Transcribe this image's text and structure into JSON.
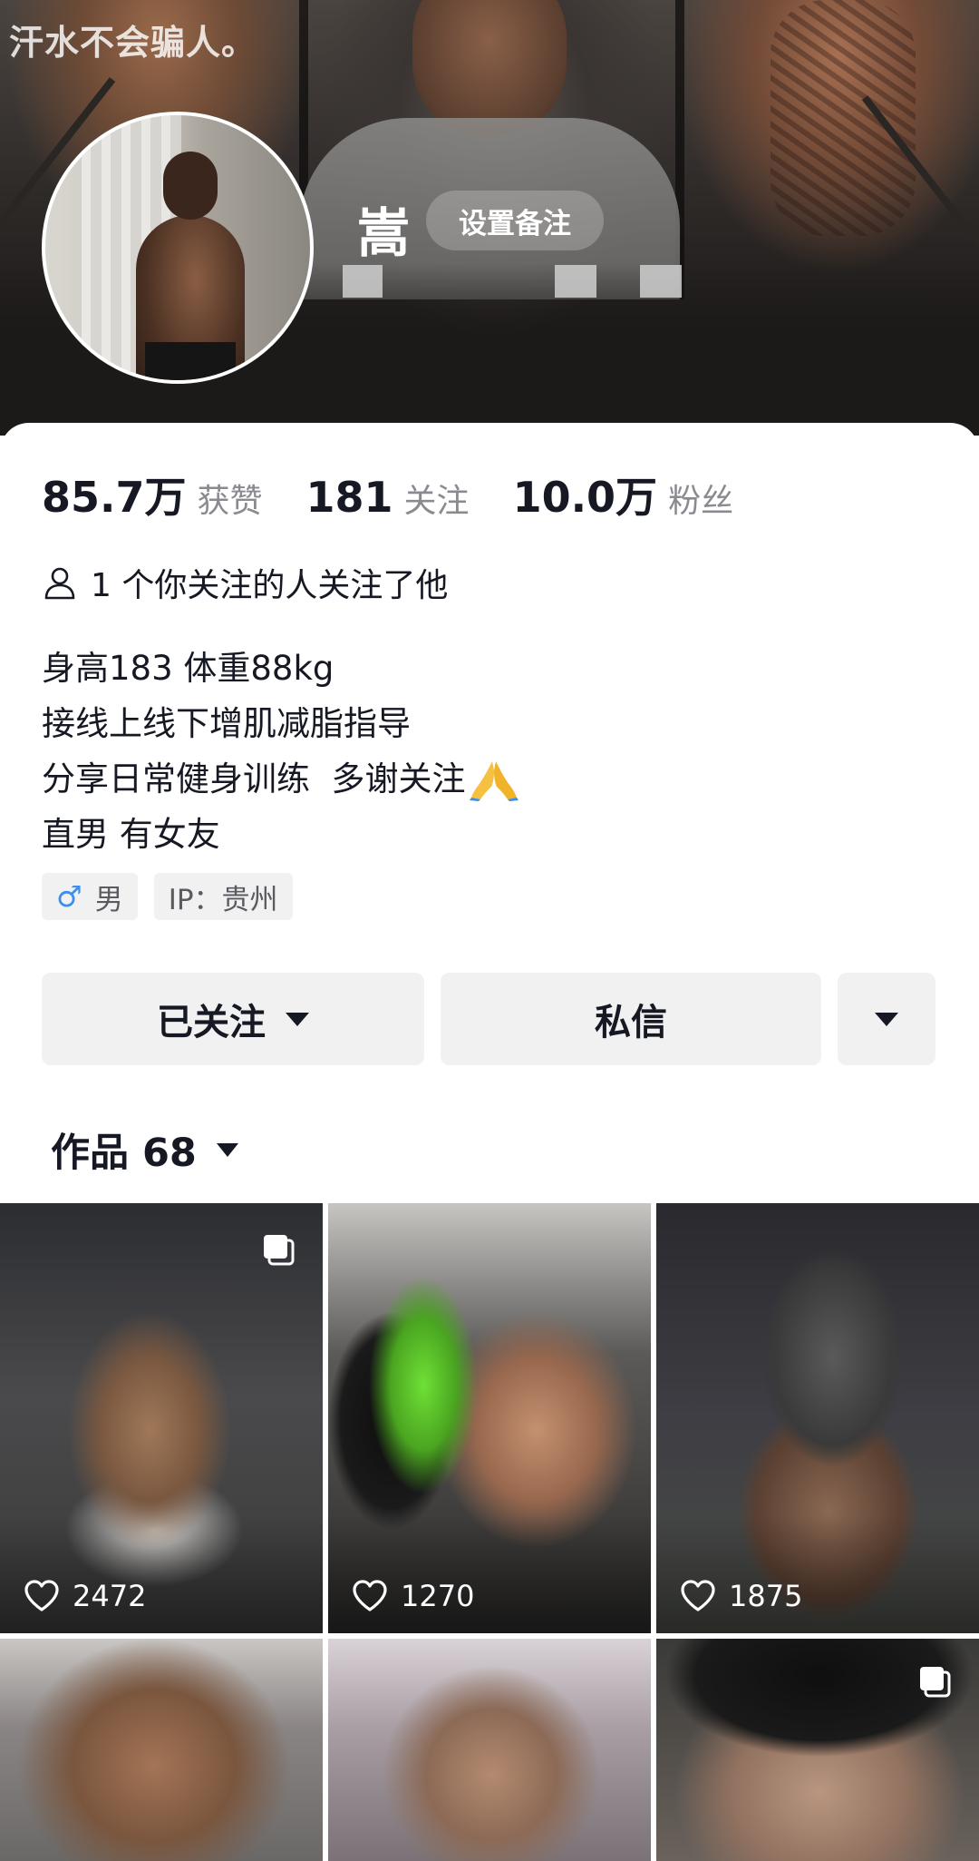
{
  "banner": {
    "slogan": "汗水不会骗人。"
  },
  "profile": {
    "name": "嵩",
    "remark_button": "设置备注",
    "stats": [
      {
        "num": "85.7万",
        "label": "获赞"
      },
      {
        "num": "181",
        "label": "关注"
      },
      {
        "num": "10.0万",
        "label": "粉丝"
      }
    ],
    "mutual": "1 个你关注的人关注了他",
    "bio": [
      "身高183 体重88kg",
      "接线上线下增肌减脂指导",
      "分享日常健身训练  多谢关注",
      "直男 有女友"
    ],
    "tags": {
      "gender_symbol": "♂",
      "gender": "男",
      "ip": "IP：贵州"
    }
  },
  "actions": {
    "follow": "已关注",
    "message": "私信"
  },
  "works": {
    "label": "作品 68",
    "items": [
      {
        "likes": "2472",
        "multi": true
      },
      {
        "likes": "1270",
        "multi": false
      },
      {
        "likes": "1875",
        "multi": false
      },
      {
        "likes": "",
        "multi": false
      },
      {
        "likes": "",
        "multi": false
      },
      {
        "likes": "",
        "multi": true
      }
    ]
  },
  "colors": {
    "accent_male": "#3d8ef0",
    "button_bg": "#f1f1f2",
    "text_primary": "#161823",
    "text_secondary": "#8a8b91"
  }
}
